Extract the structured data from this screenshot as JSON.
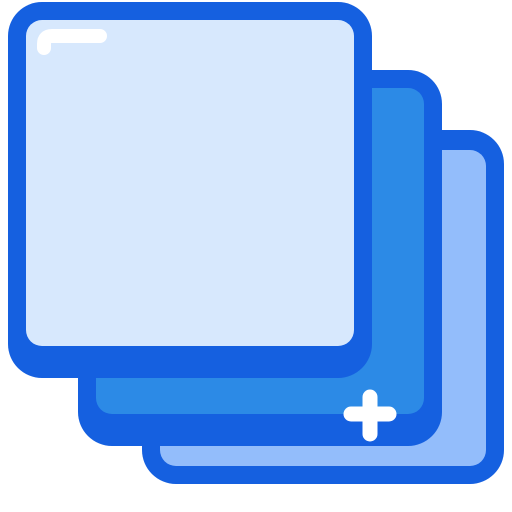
{
  "icon": {
    "name": "layers-add-icon",
    "colors": {
      "outline": "#1560e0",
      "back_layer_fill": "#93bdfb",
      "middle_layer_fill": "#2c8ae6",
      "front_layer_fill": "#d7e8fd",
      "highlight": "#ffffff",
      "plus": "#ffffff"
    }
  }
}
